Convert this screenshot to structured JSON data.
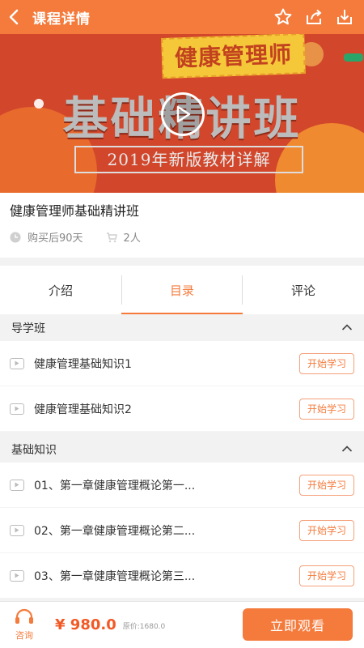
{
  "header": {
    "title": "课程详情",
    "icons": [
      "back-icon",
      "star-icon",
      "share-icon",
      "download-icon"
    ]
  },
  "banner": {
    "tag_text": "健康管理师",
    "main_text": "基础精讲班",
    "sub_text": "2019年新版教材详解"
  },
  "course": {
    "title": "健康管理师基础精讲班",
    "validity": "购买后90天",
    "buyers": "2人"
  },
  "tabs": [
    {
      "label": "介绍",
      "active": false
    },
    {
      "label": "目录",
      "active": true
    },
    {
      "label": "评论",
      "active": false
    }
  ],
  "sections": [
    {
      "title": "导学班",
      "items": [
        {
          "name": "健康管理基础知识1",
          "button": "开始学习"
        },
        {
          "name": "健康管理基础知识2",
          "button": "开始学习"
        }
      ]
    },
    {
      "title": "基础知识",
      "items": [
        {
          "name": "01、第一章健康管理概论第一...",
          "button": "开始学习"
        },
        {
          "name": "02、第一章健康管理概论第二...",
          "button": "开始学习"
        },
        {
          "name": "03、第一章健康管理概论第三...",
          "button": "开始学习"
        }
      ]
    }
  ],
  "bottom": {
    "consult_label": "咨询",
    "price": "¥ 980.0",
    "original_price": "原价:1680.0",
    "watch_button": "立即观看"
  },
  "colors": {
    "accent": "#f47b3c",
    "price": "#f25a25"
  }
}
